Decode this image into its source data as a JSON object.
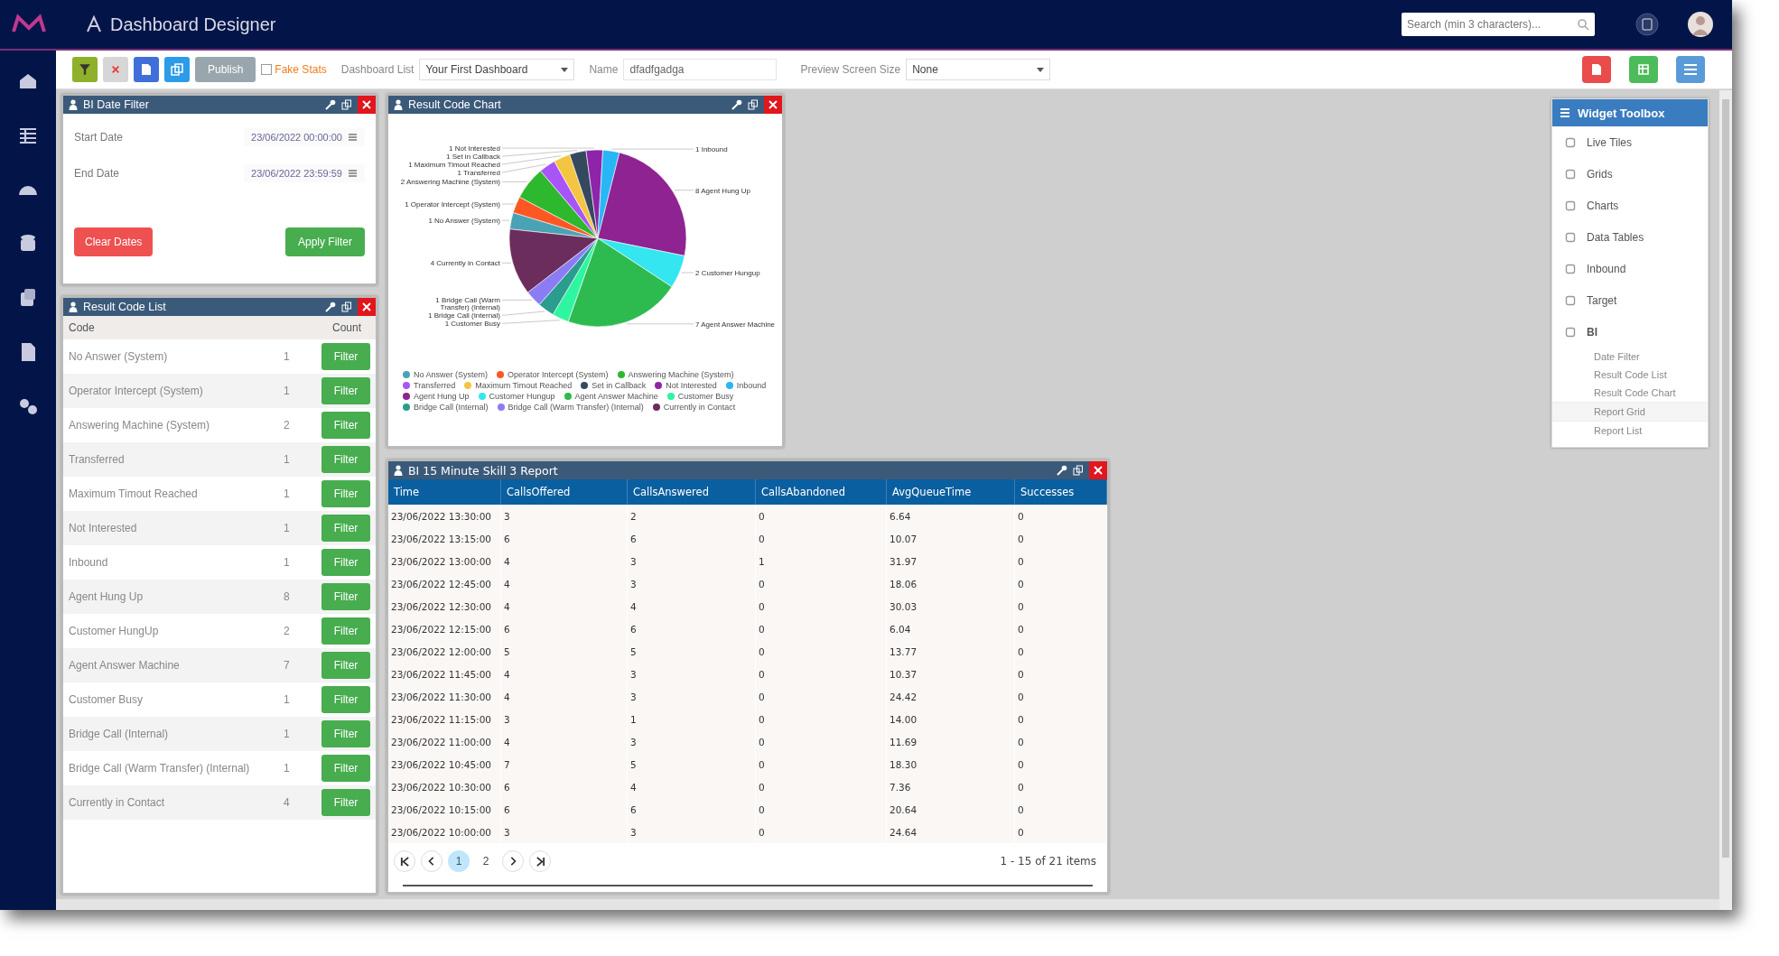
{
  "app_header": {
    "title": "Dashboard Designer",
    "search_placeholder": "Search (min 3 characters)..."
  },
  "toolbar": {
    "publish_label": "Publish",
    "fake_stats": {
      "label": "Fake Stats",
      "checked": false
    },
    "dashboard_list_label": "Dashboard List",
    "dashboard_list_value": "Your First Dashboard",
    "name_label": "Name",
    "name_value": "dfadfgadga",
    "preview_label": "Preview Screen Size",
    "preview_value": "None"
  },
  "date_filter": {
    "title": "BI Date Filter",
    "start_label": "Start Date",
    "start_value": "23/06/2022 00:00:00",
    "end_label": "End Date",
    "end_value": "23/06/2022 23:59:59",
    "clear_label": "Clear Dates",
    "apply_label": "Apply Filter"
  },
  "result_code_list": {
    "title": "Result Code List",
    "columns": [
      "Code",
      "Count"
    ],
    "rows": [
      {
        "code": "No Answer (System)",
        "count": "1",
        "button": "Filter"
      },
      {
        "code": "Operator Intercept (System)",
        "count": "1",
        "button": "Filter"
      },
      {
        "code": "Answering Machine (System)",
        "count": "2",
        "button": "Filter"
      },
      {
        "code": "Transferred",
        "count": "1",
        "button": "Filter"
      },
      {
        "code": "Maximum Timout Reached",
        "count": "1",
        "button": "Filter"
      },
      {
        "code": "Not Interested",
        "count": "1",
        "button": "Filter"
      },
      {
        "code": "Inbound",
        "count": "1",
        "button": "Filter"
      },
      {
        "code": "Agent Hung Up",
        "count": "8",
        "button": "Filter"
      },
      {
        "code": "Customer HungUp",
        "count": "2",
        "button": "Filter"
      },
      {
        "code": "Agent Answer Machine",
        "count": "7",
        "button": "Filter"
      },
      {
        "code": "Customer Busy",
        "count": "1",
        "button": "Filter"
      },
      {
        "code": "Bridge Call (Internal)",
        "count": "1",
        "button": "Filter"
      },
      {
        "code": "Bridge Call (Warm Transfer) (Internal)",
        "count": "1",
        "button": "Filter"
      },
      {
        "code": "Currently in Contact",
        "count": "4",
        "button": "Filter"
      }
    ]
  },
  "result_code_chart": {
    "title": "Result Code Chart",
    "slice_labels": {
      "left": [
        "1 Not Interested",
        "1 Set in Callback",
        "1 Maximum Timout Reached",
        "1 Transferred",
        "2 Answering Machine (System)",
        "1 Operator Intercept (System)",
        "1 No Answer (System)",
        "4 Currently in Contact",
        "1 Bridge Call (Warm Transfer) (Internal)",
        "1 Bridge Call (Internal)",
        "1 Customer Busy"
      ],
      "right": [
        "1 Inbound",
        "8 Agent Hung Up",
        "2 Customer Hungup",
        "7 Agent Answer Machine"
      ]
    },
    "chart_data": {
      "type": "pie",
      "legend": "bottom",
      "categories": [
        "No Answer (System)",
        "Operator Intercept (System)",
        "Answering Machine (System)",
        "Transferred",
        "Maximum Timout Reached",
        "Set in Callback",
        "Not Interested",
        "Inbound",
        "Agent Hung Up",
        "Customer Hungup",
        "Agent Answer Machine",
        "Customer Busy",
        "Bridge Call (Internal)",
        "Bridge Call (Warm Transfer) (Internal)",
        "Currently in Contact"
      ],
      "values": [
        3.03,
        3.03,
        6.06,
        3.03,
        3.03,
        3.03,
        3.03,
        3.03,
        24.24,
        6.06,
        21.21,
        3.03,
        3.03,
        3.03,
        12.13
      ],
      "colors": [
        "#4aa3b5",
        "#ff5722",
        "#2eb82e",
        "#a855f7",
        "#f4c542",
        "#34495e",
        "#8e24aa",
        "#29b6f6",
        "#8e2391",
        "#33e6f0",
        "#2dbb4f",
        "#2ef5a0",
        "#2a9d8f",
        "#8b7cf6",
        "#6b2d5c"
      ]
    }
  },
  "report_grid": {
    "title": "BI 15 Minute Skill 3 Report",
    "columns": [
      "Time",
      "CallsOffered",
      "CallsAnswered",
      "CallsAbandoned",
      "AvgQueueTime",
      "Successes"
    ],
    "rows": [
      [
        "23/06/2022 13:30:00",
        "3",
        "2",
        "0",
        "6.64",
        "0"
      ],
      [
        "23/06/2022 13:15:00",
        "6",
        "6",
        "0",
        "10.07",
        "0"
      ],
      [
        "23/06/2022 13:00:00",
        "4",
        "3",
        "1",
        "31.97",
        "0"
      ],
      [
        "23/06/2022 12:45:00",
        "4",
        "3",
        "0",
        "18.06",
        "0"
      ],
      [
        "23/06/2022 12:30:00",
        "4",
        "4",
        "0",
        "30.03",
        "0"
      ],
      [
        "23/06/2022 12:15:00",
        "6",
        "6",
        "0",
        "6.04",
        "0"
      ],
      [
        "23/06/2022 12:00:00",
        "5",
        "5",
        "0",
        "13.77",
        "0"
      ],
      [
        "23/06/2022 11:45:00",
        "4",
        "3",
        "0",
        "10.37",
        "0"
      ],
      [
        "23/06/2022 11:30:00",
        "4",
        "3",
        "0",
        "24.42",
        "0"
      ],
      [
        "23/06/2022 11:15:00",
        "3",
        "1",
        "0",
        "14.00",
        "0"
      ],
      [
        "23/06/2022 11:00:00",
        "4",
        "3",
        "0",
        "11.69",
        "0"
      ],
      [
        "23/06/2022 10:45:00",
        "7",
        "5",
        "0",
        "18.30",
        "0"
      ],
      [
        "23/06/2022 10:30:00",
        "6",
        "4",
        "0",
        "7.36",
        "0"
      ],
      [
        "23/06/2022 10:15:00",
        "6",
        "6",
        "0",
        "20.64",
        "0"
      ],
      [
        "23/06/2022 10:00:00",
        "3",
        "3",
        "0",
        "24.64",
        "0"
      ]
    ],
    "pager": {
      "pages": [
        {
          "label": "1",
          "selected": true
        },
        {
          "label": "2",
          "selected": false
        }
      ],
      "summary": "1 - 15 of 21 items"
    }
  },
  "widget_toolbox": {
    "title": "Widget Toolbox",
    "items": [
      {
        "label": "Live Tiles",
        "expanded": false
      },
      {
        "label": "Grids",
        "expanded": false
      },
      {
        "label": "Charts",
        "expanded": false
      },
      {
        "label": "Data Tables",
        "expanded": false
      },
      {
        "label": "Inbound",
        "expanded": false
      },
      {
        "label": "Target",
        "expanded": false
      },
      {
        "label": "BI",
        "expanded": true,
        "children": [
          {
            "label": "Date Filter",
            "selected": false
          },
          {
            "label": "Result Code List",
            "selected": false
          },
          {
            "label": "Result Code Chart",
            "selected": false
          },
          {
            "label": "Report Grid",
            "selected": true
          },
          {
            "label": "Report List",
            "selected": false
          }
        ]
      }
    ]
  }
}
